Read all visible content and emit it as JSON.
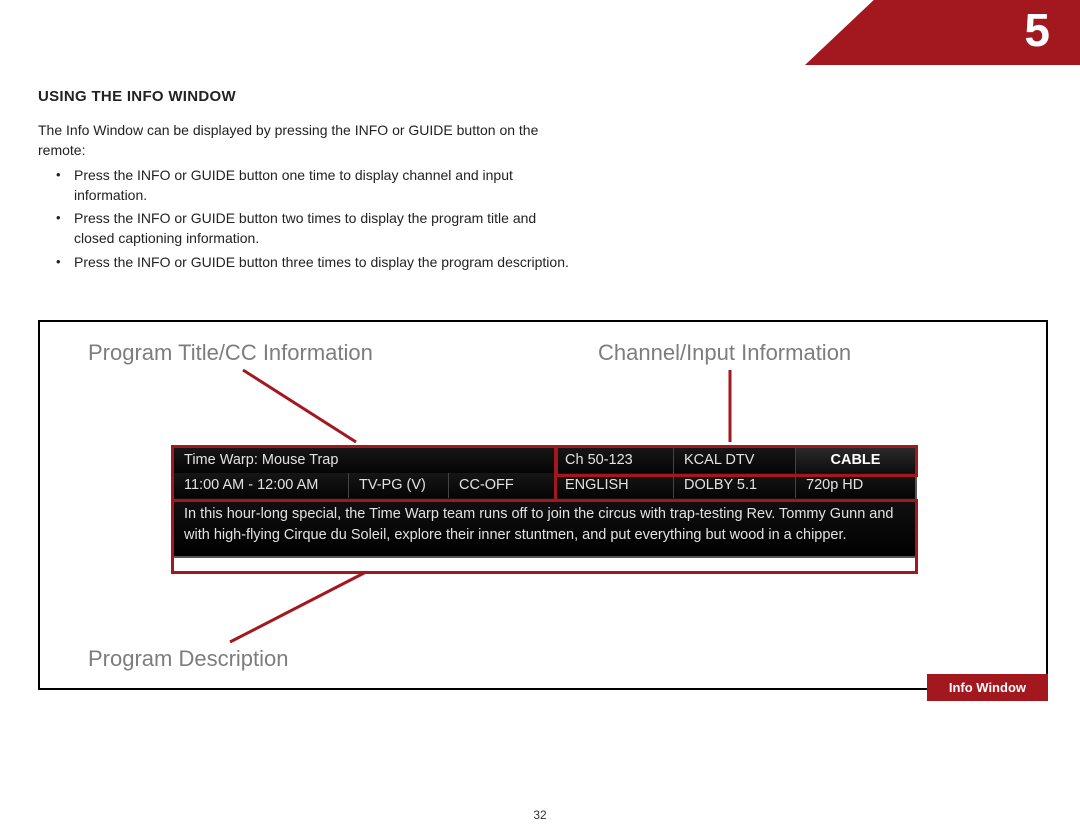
{
  "chapter_number": "5",
  "section_title": "USING THE INFO WINDOW",
  "intro": "The Info Window can be displayed by pressing the INFO or GUIDE button on the remote:",
  "bullets": [
    "Press the INFO or GUIDE button one time to display channel and input information.",
    "Press the INFO or GUIDE button two times to display the program title and closed captioning information.",
    "Press the INFO or GUIDE button three times to display the program description."
  ],
  "labels": {
    "title_cc": "Program Title/CC Information",
    "channel": "Channel/Input Information",
    "description": "Program Description"
  },
  "info_window": {
    "row1": {
      "program_title": "Time Warp: Mouse Trap",
      "channel_num": "Ch 50-123",
      "station": "KCAL DTV",
      "input": "CABLE"
    },
    "row2": {
      "time": "11:00 AM - 12:00 AM",
      "rating": "TV-PG (V)",
      "cc": "CC-OFF",
      "language": "ENGLISH",
      "audio": "DOLBY 5.1",
      "resolution": "720p HD"
    },
    "description": "In this hour-long special, the Time Warp team runs off to join the circus with trap-testing Rev. Tommy Gunn and with high-flying Cirque du Soleil, explore their inner stuntmen, and put everything but wood in a chipper."
  },
  "badge": "Info Window",
  "page_number": "32"
}
